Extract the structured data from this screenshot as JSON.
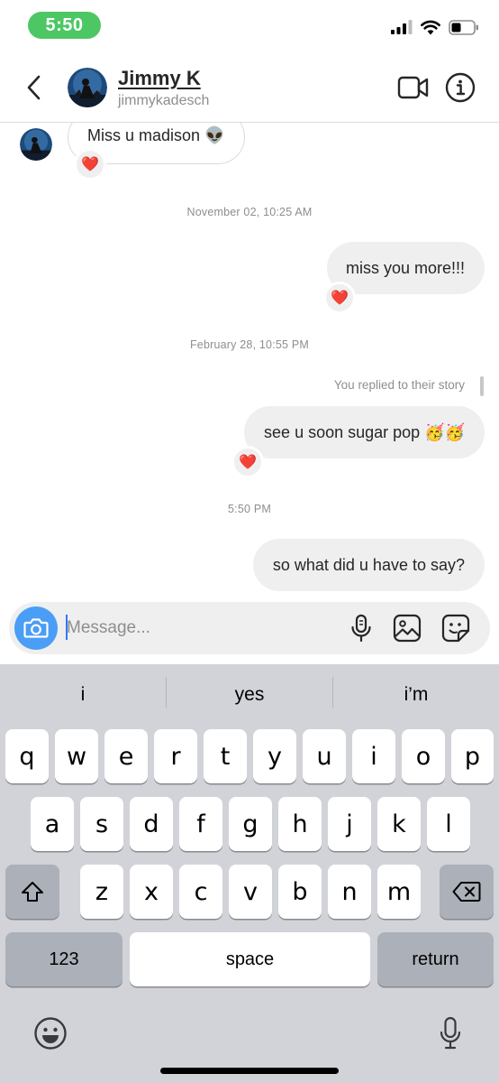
{
  "status_bar": {
    "time": "5:50",
    "time_pill_color": "#4cc764",
    "icons": [
      "cellular-signal-icon",
      "wifi-icon",
      "battery-icon"
    ]
  },
  "header": {
    "name": "Jimmy K",
    "username": "jimmykadesch",
    "icons": [
      "back-chevron-icon",
      "video-camera-icon",
      "info-icon"
    ]
  },
  "messages": [
    {
      "type": "incoming",
      "text": "Miss u madison 👽",
      "reaction": "❤️"
    },
    {
      "type": "timestamp",
      "text": "November 02, 10:25 AM"
    },
    {
      "type": "outgoing",
      "text": "miss you more!!!",
      "reaction": "❤️"
    },
    {
      "type": "timestamp",
      "text": "February 28, 10:55 PM"
    },
    {
      "type": "story_reply_note",
      "text": "You replied to their story"
    },
    {
      "type": "outgoing",
      "text": "see u soon sugar pop 🥳🥳",
      "reaction": "❤️"
    },
    {
      "type": "timestamp",
      "text": "5:50 PM"
    },
    {
      "type": "outgoing",
      "text": "so what did u have to say?"
    }
  ],
  "composer": {
    "placeholder": "Message...",
    "icons": [
      "camera-icon",
      "microphone-icon",
      "gallery-icon",
      "sticker-icon"
    ],
    "camera_color": "#4a9ef5"
  },
  "keyboard": {
    "suggestions": [
      "i",
      "yes",
      "i’m"
    ],
    "row1": [
      "q",
      "w",
      "e",
      "r",
      "t",
      "y",
      "u",
      "i",
      "o",
      "p"
    ],
    "row2": [
      "a",
      "s",
      "d",
      "f",
      "g",
      "h",
      "j",
      "k",
      "l"
    ],
    "row3": [
      "z",
      "x",
      "c",
      "v",
      "b",
      "n",
      "m"
    ],
    "numbers_label": "123",
    "space_label": "space",
    "return_label": "return"
  }
}
